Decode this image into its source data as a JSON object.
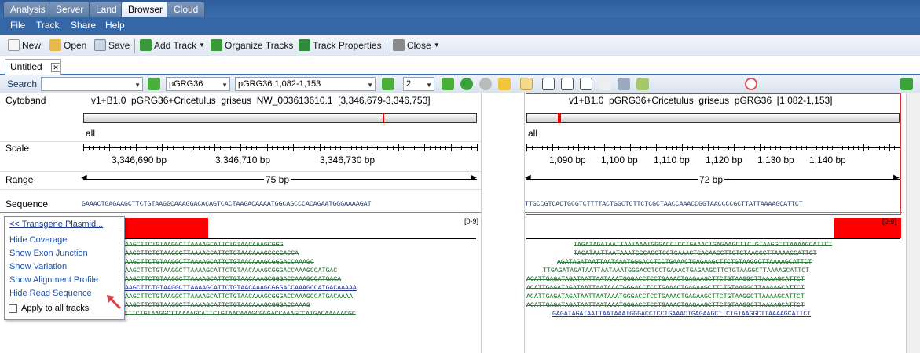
{
  "tabs": [
    "Analysis",
    "Server",
    "Land",
    "Browser",
    "Cloud"
  ],
  "menu": [
    "File",
    "Track",
    "Share",
    "Help"
  ],
  "toolbar": {
    "new": "New",
    "open": "Open",
    "save": "Save",
    "add_track": "Add Track",
    "organize_tracks": "Organize Tracks",
    "track_properties": "Track Properties",
    "close": "Close"
  },
  "document_tab": "Untitled",
  "search": {
    "label": "Search",
    "value": "",
    "genome": "pGRG36",
    "location": "pGRG36:1,082-1,153",
    "zoom": "2"
  },
  "left_panel": {
    "cytoband_label": "Cytoband",
    "title": "v1+B1.0  pGRG36+Cricetulus  griseus  NW_003613610.1  [3,346,679-3,346,753]",
    "chrom": "all",
    "scale_label": "Scale",
    "scale_ticks": [
      "3,346,690 bp",
      "3,346,710 bp",
      "3,346,730 bp"
    ],
    "range_label": "Range",
    "range": "75 bp",
    "sequence_label": "Sequence",
    "sequence": "GAAACTGAGAAGCTTCTGTAAGGCAAAGGACACAGTCACTAAGACAAAATGGCAGCCCACAGAATGGGAAAAGAT",
    "coverage_range": "[0-9]",
    "reads": [
      "AAGCTTCTGTAAGGCTTAAAAGCATTCTGTAACAAAGCGGG",
      "AAGCTTCTGTAAGGCTTAAAAGCATTCTGTAACAAAGCGGGACCA",
      "AAGCTTCTGTAAGGCTTAAAAGCATTCTGTAACAAAGCGGGACCAAAGC",
      "AAGCTTCTGTAAGGCTTAAAAGCATTCTGTAACAAAGCGGGACCAAAGCCATGAC",
      "AAGCTTCTGTAAGGCTTAAAAGCATTCTGTAACAAAGCGGGACCAAAGCCATGACA",
      "AAGCTTCTGTAAGGCTTAAAAGCATTCTGTAACAAAGCGGGACCAAAGCCATGACAAAAA",
      "AAGCTTCTGTAAGGCTTAAAAGCATTCTGTAACAAAGCGGGACCAAAGCCATGACAAAA",
      "AAGCTTCTGTAAGGCTTAAAAGCATTCTGTAACAAAGCGGGACCAAAG",
      "AAACTGAGAAGCTTCTGTAAGGCTTAAAAGCATTCTGTAACAAAGCGGGACCAAAGCCATGACAAAAACGC"
    ]
  },
  "right_panel": {
    "title": "v1+B1.0  pGRG36+Cricetulus  griseus  pGRG36  [1,082-1,153]",
    "chrom": "all",
    "scale_ticks": [
      "1,090 bp",
      "1,100 bp",
      "1,110 bp",
      "1,120 bp",
      "1,130 bp",
      "1,140 bp"
    ],
    "range": "72 bp",
    "sequence": "TTGCCGTCACTGCGTCTTTTACTGGCTCTTCTCGCTAACCAAACCGGTAACCCCGCTTATTAAAAGCATTCT",
    "coverage_range": "[0-9]",
    "reads": [
      "TAGATAGATAATTAATAAATGGGACCTCCTGAAACTGAGAAGCTTCTGTAAGGCTTAAAAGCATTCT",
      "TAGATAATTAATAAATGGGACCTCCTGAAACTGAGAAGCTTCTGTAAGGCTTAAAAGCATTCT",
      "AGATAGATAATTAATAAATGGGACCTCCTGAAACTGAGAAGCTTCTGTAAGGCTTAAAAGCATTCT",
      "TTGAGATAGATAATTAATAAATGGGACCTCCTGAAACTGAGAAGCTTCTGTAAGGCTTAAAAGCATTCT",
      "ACATTGAGATAGATAATTAATAAATGGGACCTCCTGAAACTGAGAAGCTTCTGTAAGGCTTAAAAGCATTCT",
      "ACATTGAGATAGATAATTAATAAATGGGACCTCCTGAAACTGAGAAGCTTCTGTAAGGCTTAAAAGCATTCT",
      "ACATTGAGATAGATAATTAATAAATGGGACCTCCTGAAACTGAGAAGCTTCTGTAAGGCTTAAAAGCATTCT",
      "ACATTGAGATAGATAATTAATAAATGGGACCTCCTGAAACTGAGAAGCTTCTGTAAGGCTTAAAAGCATTCT",
      "GAGATAGATAATTAATAAATGGGACCTCCTGAAACTGAGAAGCTTCTGTAAGGCTTAAAAGCATTCT"
    ]
  },
  "popup": {
    "header": "<< Transgene.Plasmid...",
    "items": [
      "Hide Coverage",
      "Show Exon Junction",
      "Show Variation",
      "Show Alignment Profile",
      "Hide Read Sequence"
    ],
    "checkbox": "Apply to all tracks"
  },
  "colors": {
    "accent": "#3567a6",
    "coverage": "#ff0000"
  }
}
